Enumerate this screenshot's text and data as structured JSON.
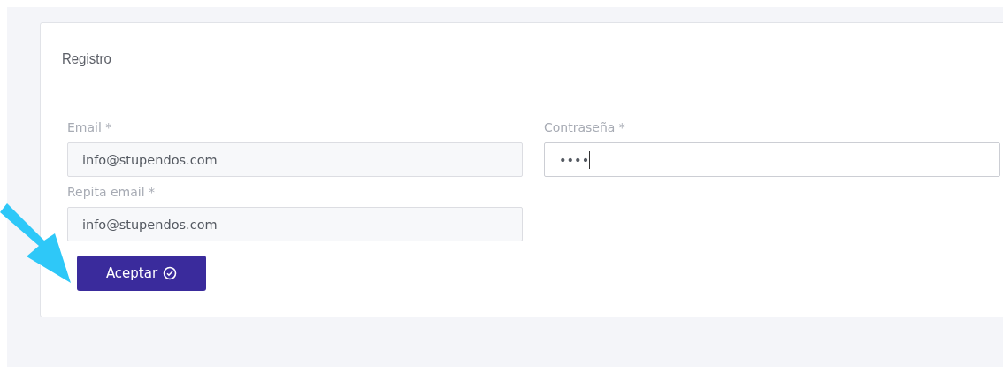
{
  "card": {
    "title": "Registro"
  },
  "left_column": [
    {
      "label": "Email *",
      "value": "info@stupendos.com",
      "focused": false
    },
    {
      "label": "Repita email *",
      "value": "info@stupendos.com",
      "focused": false
    }
  ],
  "right_column": [
    {
      "label": "Contraseña *",
      "value": "••••",
      "focused": true
    }
  ],
  "button": {
    "label": "Aceptar"
  }
}
